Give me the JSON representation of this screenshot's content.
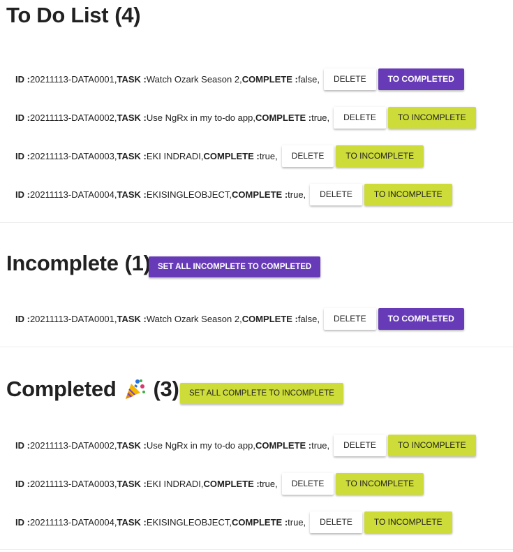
{
  "todo": {
    "title": "To Do List",
    "count": "(4)",
    "items": [
      {
        "id_label": "ID :",
        "id": "20211113-DATA0001,",
        "task_label": "TASK :",
        "task": "Watch Ozark Season 2,",
        "complete_label": "COMPLETE :",
        "complete": "false,",
        "delete_label": "DELETE",
        "toggle_label": "TO COMPLETED",
        "toggle_kind": "completed"
      },
      {
        "id_label": "ID :",
        "id": "20211113-DATA0002,",
        "task_label": "TASK :",
        "task": "Use NgRx in my to-do app,",
        "complete_label": "COMPLETE :",
        "complete": "true,",
        "delete_label": "DELETE",
        "toggle_label": "TO INCOMPLETE",
        "toggle_kind": "incomplete"
      },
      {
        "id_label": "ID :",
        "id": "20211113-DATA0003,",
        "task_label": "TASK :",
        "task": "EKI INDRADI,",
        "complete_label": "COMPLETE :",
        "complete": "true,",
        "delete_label": "DELETE",
        "toggle_label": "TO INCOMPLETE",
        "toggle_kind": "incomplete"
      },
      {
        "id_label": "ID :",
        "id": "20211113-DATA0004,",
        "task_label": "TASK :",
        "task": "EKISINGLEOBJECT,",
        "complete_label": "COMPLETE :",
        "complete": "true,",
        "delete_label": "DELETE",
        "toggle_label": "TO INCOMPLETE",
        "toggle_kind": "incomplete"
      }
    ]
  },
  "incomplete": {
    "title": "Incomplete",
    "count": "(1)",
    "action_label": "SET ALL INCOMPLETE TO COMPLETED",
    "items": [
      {
        "id_label": "ID :",
        "id": "20211113-DATA0001,",
        "task_label": "TASK :",
        "task": "Watch Ozark Season 2,",
        "complete_label": "COMPLETE :",
        "complete": "false,",
        "delete_label": "DELETE",
        "toggle_label": "TO COMPLETED",
        "toggle_kind": "completed"
      }
    ]
  },
  "completed": {
    "title": "Completed",
    "emoji_icon": "party-popper-icon",
    "count": "(3)",
    "action_label": "SET ALL COMPLETE TO INCOMPLETE",
    "items": [
      {
        "id_label": "ID :",
        "id": "20211113-DATA0002,",
        "task_label": "TASK :",
        "task": "Use NgRx in my to-do app,",
        "complete_label": "COMPLETE :",
        "complete": "true,",
        "delete_label": "DELETE",
        "toggle_label": "TO INCOMPLETE",
        "toggle_kind": "incomplete"
      },
      {
        "id_label": "ID :",
        "id": "20211113-DATA0003,",
        "task_label": "TASK :",
        "task": "EKI INDRADI,",
        "complete_label": "COMPLETE :",
        "complete": "true,",
        "delete_label": "DELETE",
        "toggle_label": "TO INCOMPLETE",
        "toggle_kind": "incomplete"
      },
      {
        "id_label": "ID :",
        "id": "20211113-DATA0004,",
        "task_label": "TASK :",
        "task": "EKISINGLEOBJECT,",
        "complete_label": "COMPLETE :",
        "complete": "true,",
        "delete_label": "DELETE",
        "toggle_label": "TO INCOMPLETE",
        "toggle_kind": "incomplete"
      }
    ]
  },
  "colors": {
    "primary": "#673ab7",
    "accent": "#cddc39",
    "text": "#212121"
  }
}
